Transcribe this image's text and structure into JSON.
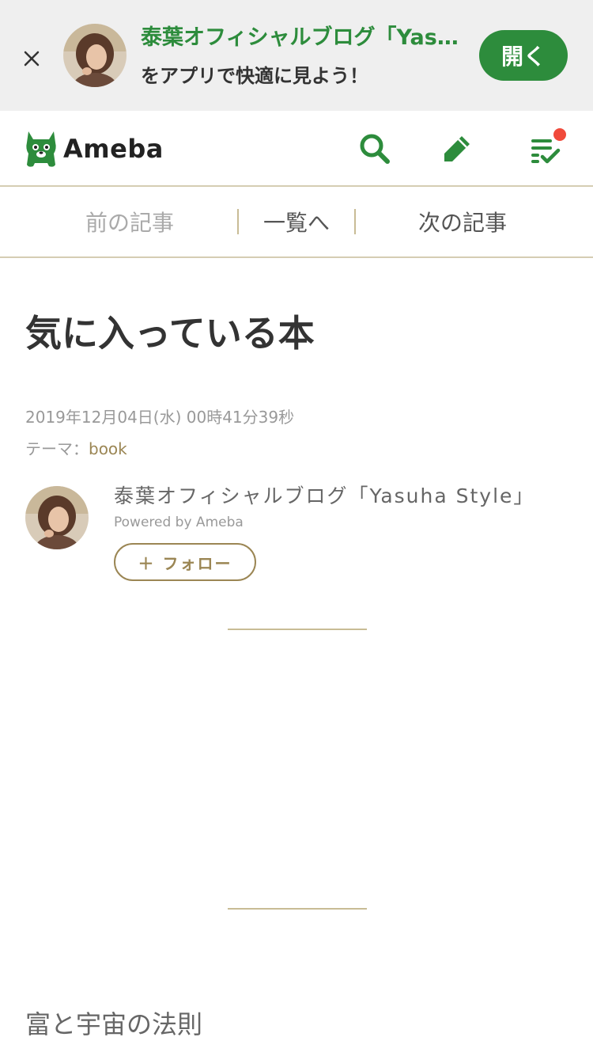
{
  "app_banner": {
    "title": "泰葉オフィシャルブログ「Yasuha Style」",
    "subtitle": "をアプリで快適に見よう！",
    "open_label": "開く"
  },
  "header": {
    "logo_text": "Ameba",
    "icons": [
      "search-icon",
      "pencil-icon",
      "checklist-icon"
    ],
    "brand_color": "#2d8c3c",
    "notification_dot_color": "#f04a3b"
  },
  "article_nav": {
    "prev_label": "前の記事",
    "list_label": "一覧へ",
    "next_label": "次の記事"
  },
  "article": {
    "title": "気に入っている本",
    "date": "2019年12月04日(水) 00時41分39秒",
    "theme_label": "テーマ：",
    "theme_value": "book"
  },
  "author": {
    "blog_name": "泰葉オフィシャルブログ「Yasuha Style」",
    "powered_by": "Powered by Ameba",
    "follow_label": "＋ フォロー"
  },
  "content": {
    "book_heading": "富と宇宙の法則"
  }
}
